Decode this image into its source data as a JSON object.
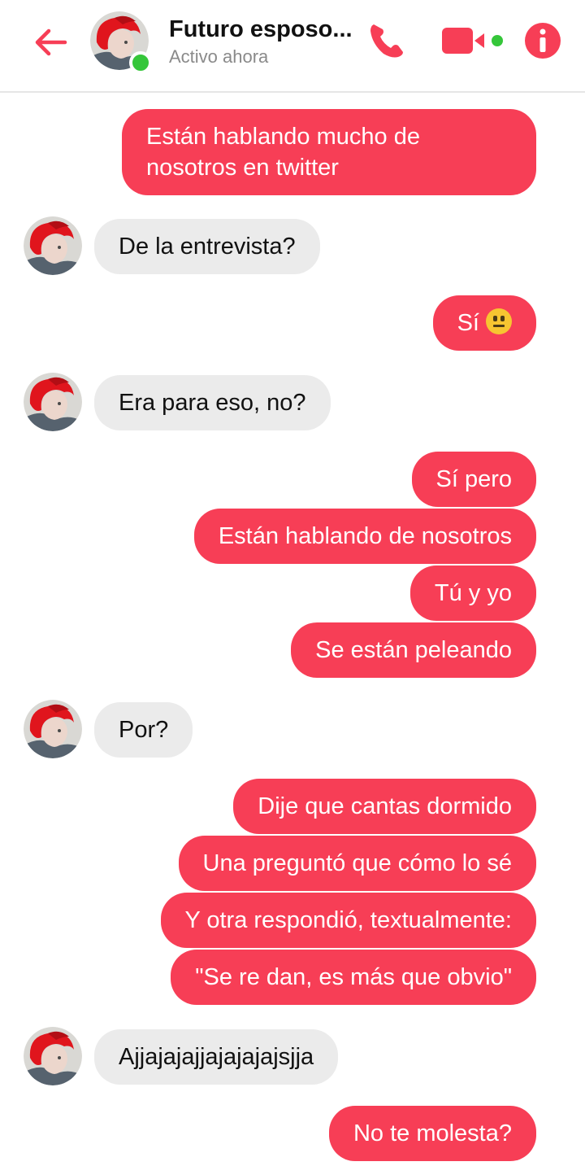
{
  "header": {
    "contact_name": "Futuro esposo...",
    "status": "Activo ahora",
    "icons": {
      "back": "back-arrow-icon",
      "call": "phone-icon",
      "video": "video-camera-icon",
      "info": "info-icon"
    },
    "accent_color": "#f73e56",
    "online_color": "#35c63a"
  },
  "messages": [
    {
      "side": "out",
      "text": "Están hablando mucho de nosotros en twitter"
    },
    {
      "side": "in",
      "text": "De la entrevista?"
    },
    {
      "side": "out",
      "text": "Sí",
      "emoji": "neutral-face"
    },
    {
      "side": "in",
      "text": "Era para eso, no?"
    },
    {
      "side": "out",
      "text": "Sí pero"
    },
    {
      "side": "out",
      "text": "Están hablando de nosotros"
    },
    {
      "side": "out",
      "text": "Tú y yo"
    },
    {
      "side": "out",
      "text": "Se están peleando"
    },
    {
      "side": "in",
      "text": "Por?"
    },
    {
      "side": "out",
      "text": "Dije que cantas dormido"
    },
    {
      "side": "out",
      "text": "Una preguntó que cómo lo sé"
    },
    {
      "side": "out",
      "text": "Y otra respondió, textualmente:"
    },
    {
      "side": "out",
      "text": "\"Se re dan, es más que obvio\""
    },
    {
      "side": "in",
      "text": "Ajjajajajjajajajajsjja"
    },
    {
      "side": "out",
      "text": "No te molesta?"
    }
  ]
}
